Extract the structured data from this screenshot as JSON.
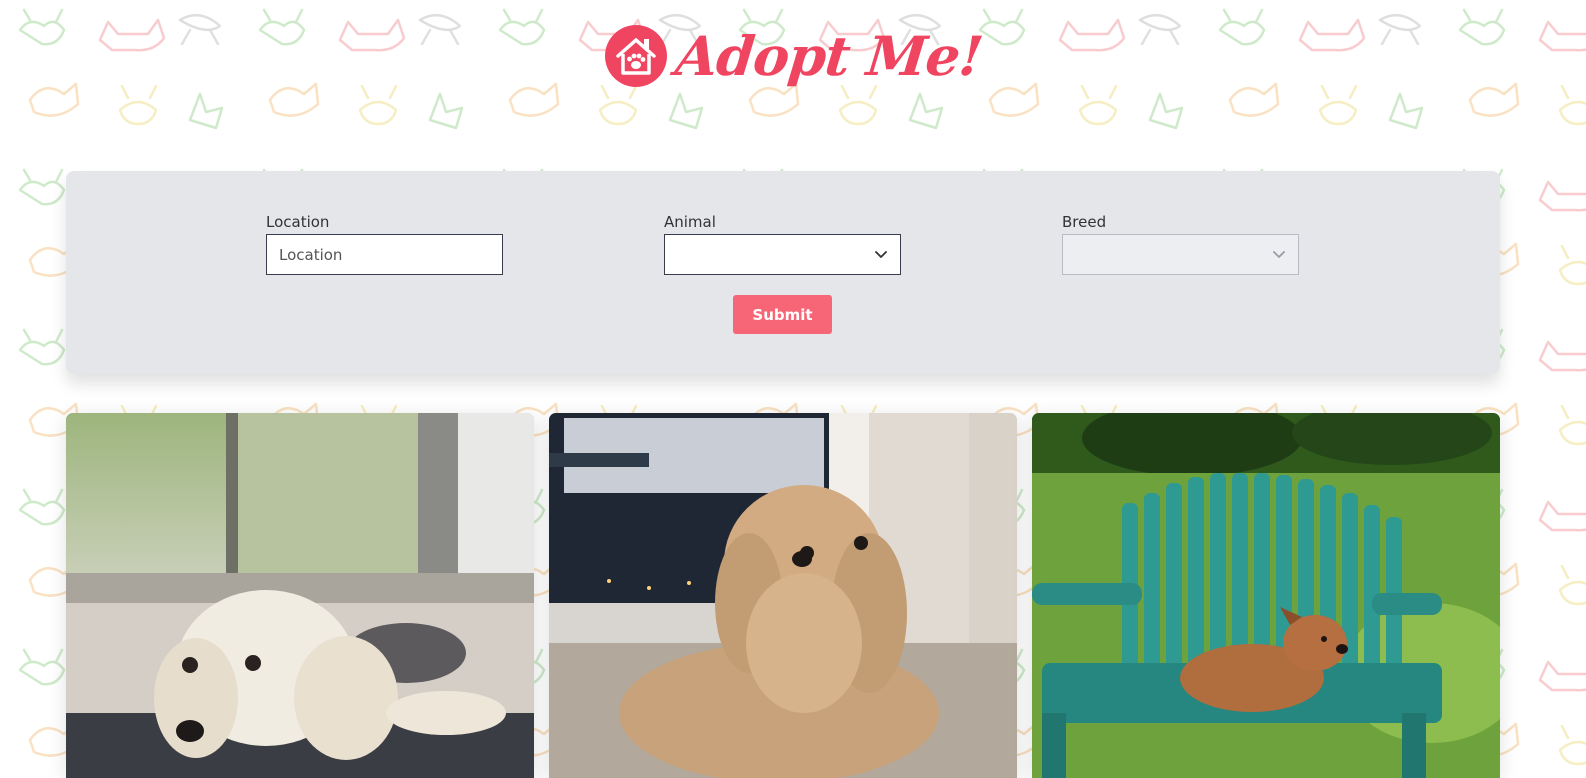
{
  "header": {
    "logo_icon": "house-paw-icon",
    "title": "Adopt Me!"
  },
  "search": {
    "location": {
      "label": "Location",
      "placeholder": "Location",
      "value": ""
    },
    "animal": {
      "label": "Animal",
      "selected": ""
    },
    "breed": {
      "label": "Breed",
      "selected": "",
      "disabled": true
    },
    "submit_label": "Submit"
  },
  "results": [
    {
      "photo": "white-fluffy-dog-photo"
    },
    {
      "photo": "curly-tan-dog-photo"
    },
    {
      "photo": "brown-dog-on-green-chair-photo"
    }
  ],
  "colors": {
    "brand": "#f04560",
    "button": "#f76677",
    "panel": "#e5e6ea"
  }
}
